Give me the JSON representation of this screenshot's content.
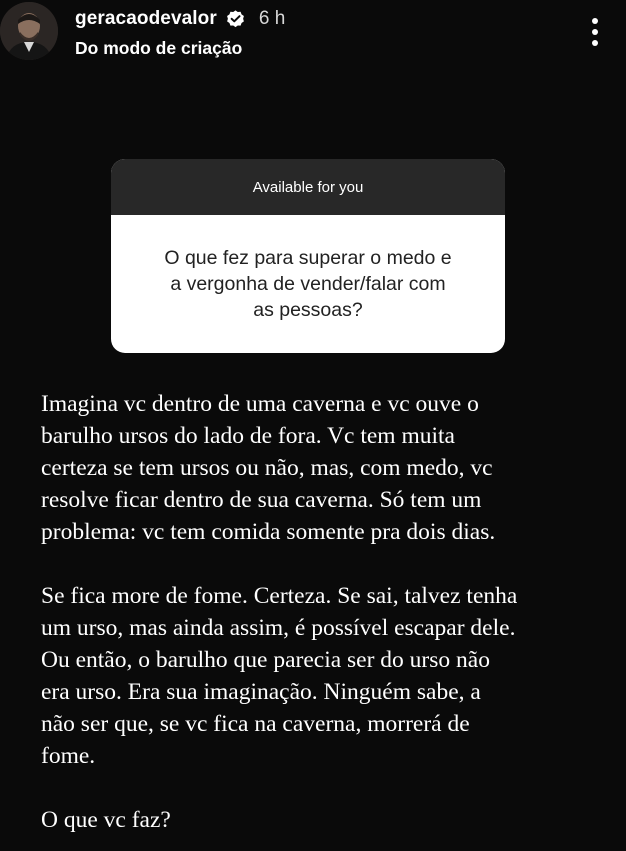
{
  "header": {
    "username": "geracaodevalor",
    "time": "6 h",
    "subtitle": "Do modo de criação"
  },
  "icons": {
    "avatar": "profile-photo",
    "verified": "verified-badge-icon",
    "more": "more-vertical-icon"
  },
  "question_card": {
    "header": "Available for you",
    "question": "O que fez para superar o medo e\na vergonha de vender/falar com\nas pessoas?"
  },
  "story": {
    "paragraph1": "Imagina vc dentro de uma caverna e vc ouve o\nbarulho ursos do lado de fora. Vc tem muita\ncerteza se tem ursos ou não, mas, com medo, vc\nresolve ficar dentro de sua caverna. Só tem um\nproblema: vc tem comida somente pra dois dias.",
    "paragraph2": "Se fica more de fome. Certeza. Se sai, talvez tenha\num urso, mas ainda assim, é possível escapar dele.\nOu então, o barulho que parecia ser do urso não\nera urso. Era sua imaginação. Ninguém sabe, a\nnão ser que, se vc fica na caverna, morrerá de\nfome.",
    "paragraph3": "O que vc faz?"
  },
  "colors": {
    "background": "#0a0a0a",
    "card_header": "#282828",
    "card_body": "#ffffff",
    "verified_blue": "#ffffff"
  }
}
